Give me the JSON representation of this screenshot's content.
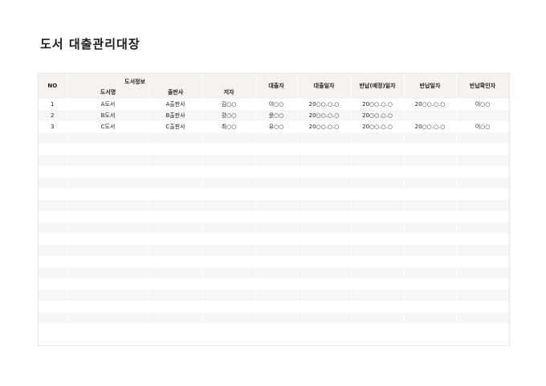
{
  "title": "도서  대출관리대장",
  "headers": {
    "no": "NO",
    "book_info": "도서정보",
    "book_name": "도서명",
    "publisher": "출판사",
    "author": "저자",
    "borrower": "대출자",
    "loan_date": "대출일자",
    "due_date": "반납(예정)일자",
    "return_date": "반납일자",
    "return_confirm": "반납확인자"
  },
  "rows": [
    {
      "no": "1",
      "book": "A도서",
      "publisher": "A출판사",
      "author": "김○○",
      "borrower": "이○○",
      "loan_date": "20○○.○.○",
      "due_date": "20○○.○.○",
      "return_date": "20○○.○.○",
      "confirm": "이○○"
    },
    {
      "no": "2",
      "book": "B도서",
      "publisher": "B출판사",
      "author": "강○○",
      "borrower": "윤○○",
      "loan_date": "20○○.○.○",
      "due_date": "20○○.○.○",
      "return_date": "",
      "confirm": ""
    },
    {
      "no": "3",
      "book": "C도서",
      "publisher": "C출판사",
      "author": "최○○",
      "borrower": "유○○",
      "loan_date": "20○○.○.○",
      "due_date": "20○○.○.○",
      "return_date": "20○○.○.○",
      "confirm": "이○○"
    }
  ],
  "empty_row_count": 17
}
